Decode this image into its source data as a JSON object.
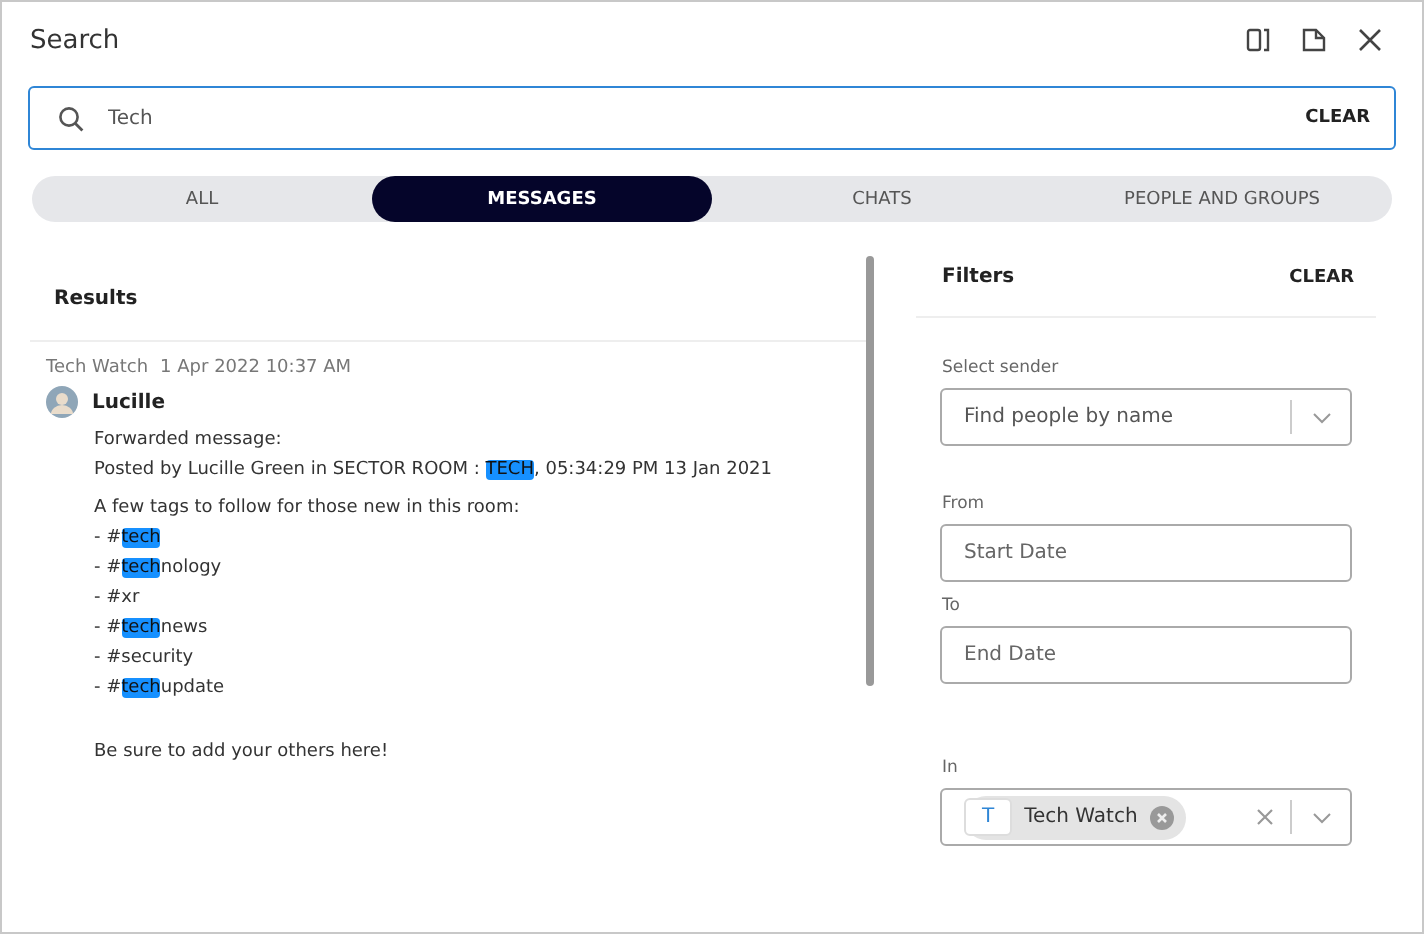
{
  "window": {
    "title": "Search"
  },
  "search": {
    "value": "Tech",
    "clear_label": "CLEAR"
  },
  "tabs": [
    {
      "label": "ALL",
      "selected": false
    },
    {
      "label": "MESSAGES",
      "selected": true
    },
    {
      "label": "CHATS",
      "selected": false
    },
    {
      "label": "PEOPLE AND GROUPS",
      "selected": false
    }
  ],
  "results": {
    "title": "Results",
    "message": {
      "room": "Tech Watch",
      "time": "1 Apr 2022 10:37 AM",
      "sender": "Lucille",
      "paragraphs": [
        [
          [
            {
              "text": "Forwarded message:",
              "highlight": false
            }
          ],
          [
            {
              "text": "Posted by Lucille Green in SECTOR ROOM : ",
              "highlight": false
            },
            {
              "text": "TECH",
              "highlight": true
            },
            {
              "text": ", 05:34:29 PM 13 Jan 2021",
              "highlight": false
            }
          ]
        ],
        [
          [
            {
              "text": "A few tags to follow for those new in this room:",
              "highlight": false
            }
          ],
          [
            {
              "text": "- #",
              "highlight": false
            },
            {
              "text": "tech",
              "highlight": true
            }
          ],
          [
            {
              "text": "- #",
              "highlight": false
            },
            {
              "text": "tech",
              "highlight": true
            },
            {
              "text": "nology",
              "highlight": false
            }
          ],
          [
            {
              "text": "- #xr",
              "highlight": false
            }
          ],
          [
            {
              "text": "- #",
              "highlight": false
            },
            {
              "text": "tech",
              "highlight": true
            },
            {
              "text": "news",
              "highlight": false
            }
          ],
          [
            {
              "text": "- #security",
              "highlight": false
            }
          ],
          [
            {
              "text": "- #",
              "highlight": false
            },
            {
              "text": "tech",
              "highlight": true
            },
            {
              "text": "update",
              "highlight": false
            }
          ]
        ],
        [
          [
            {
              "text": "Be sure to add your others here!",
              "highlight": false
            }
          ]
        ]
      ]
    }
  },
  "filters": {
    "title": "Filters",
    "clear_label": "CLEAR",
    "sender": {
      "label": "Select sender",
      "placeholder": "Find people by name"
    },
    "from": {
      "label": "From",
      "placeholder": "Start Date"
    },
    "to": {
      "label": "To",
      "placeholder": "End Date"
    },
    "in": {
      "label": "In",
      "chip": {
        "initial": "T",
        "name": "Tech Watch"
      }
    }
  }
}
